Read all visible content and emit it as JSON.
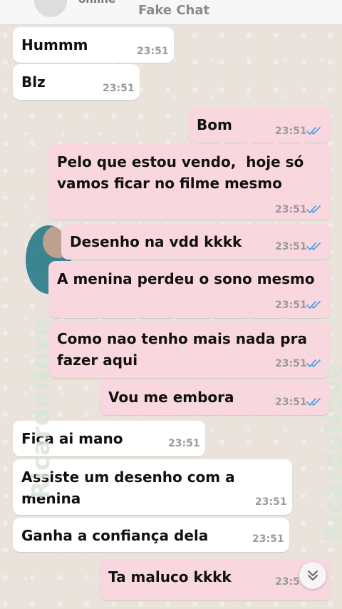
{
  "header": {
    "status": "online",
    "title": "Fake Chat"
  },
  "watermark": {
    "text": "RicardoNove"
  },
  "messages": [
    {
      "side": "in",
      "text": "Hummm",
      "time": "23:51"
    },
    {
      "side": "in",
      "text": "Blz",
      "time": "23:51"
    },
    {
      "side": "out",
      "text": "Bom",
      "time": "23:51",
      "read": true
    },
    {
      "side": "out",
      "text": "Pelo que estou vendo,  hoje só vamos ficar no filme mesmo",
      "time": "23:51",
      "read": true
    },
    {
      "side": "out",
      "text": "Desenho na vdd kkkk",
      "time": "23:51",
      "read": true
    },
    {
      "side": "out",
      "text": "A menina perdeu o sono mesmo",
      "time": "23:51",
      "read": true
    },
    {
      "side": "out",
      "text": "Como nao tenho mais nada pra fazer aqui",
      "time": "23:51",
      "read": true
    },
    {
      "side": "out",
      "text": "Vou me embora",
      "time": "23:51",
      "read": true
    },
    {
      "side": "in",
      "text": "Fica ai mano",
      "time": "23:51"
    },
    {
      "side": "in",
      "text": "Assiste um desenho com a menina",
      "time": "23:51"
    },
    {
      "side": "in",
      "text": "Ganha a confiança dela",
      "time": "23:51"
    },
    {
      "side": "out",
      "text": "Ta maluco kkkk",
      "time": "23:5",
      "read": true
    }
  ],
  "colors": {
    "incoming": "#ffffff",
    "outgoing": "#f9d7df",
    "read_tick": "#4fa3e0"
  },
  "icons": {
    "scroll": "chevron-double-down-icon",
    "read": "double-check-icon"
  }
}
